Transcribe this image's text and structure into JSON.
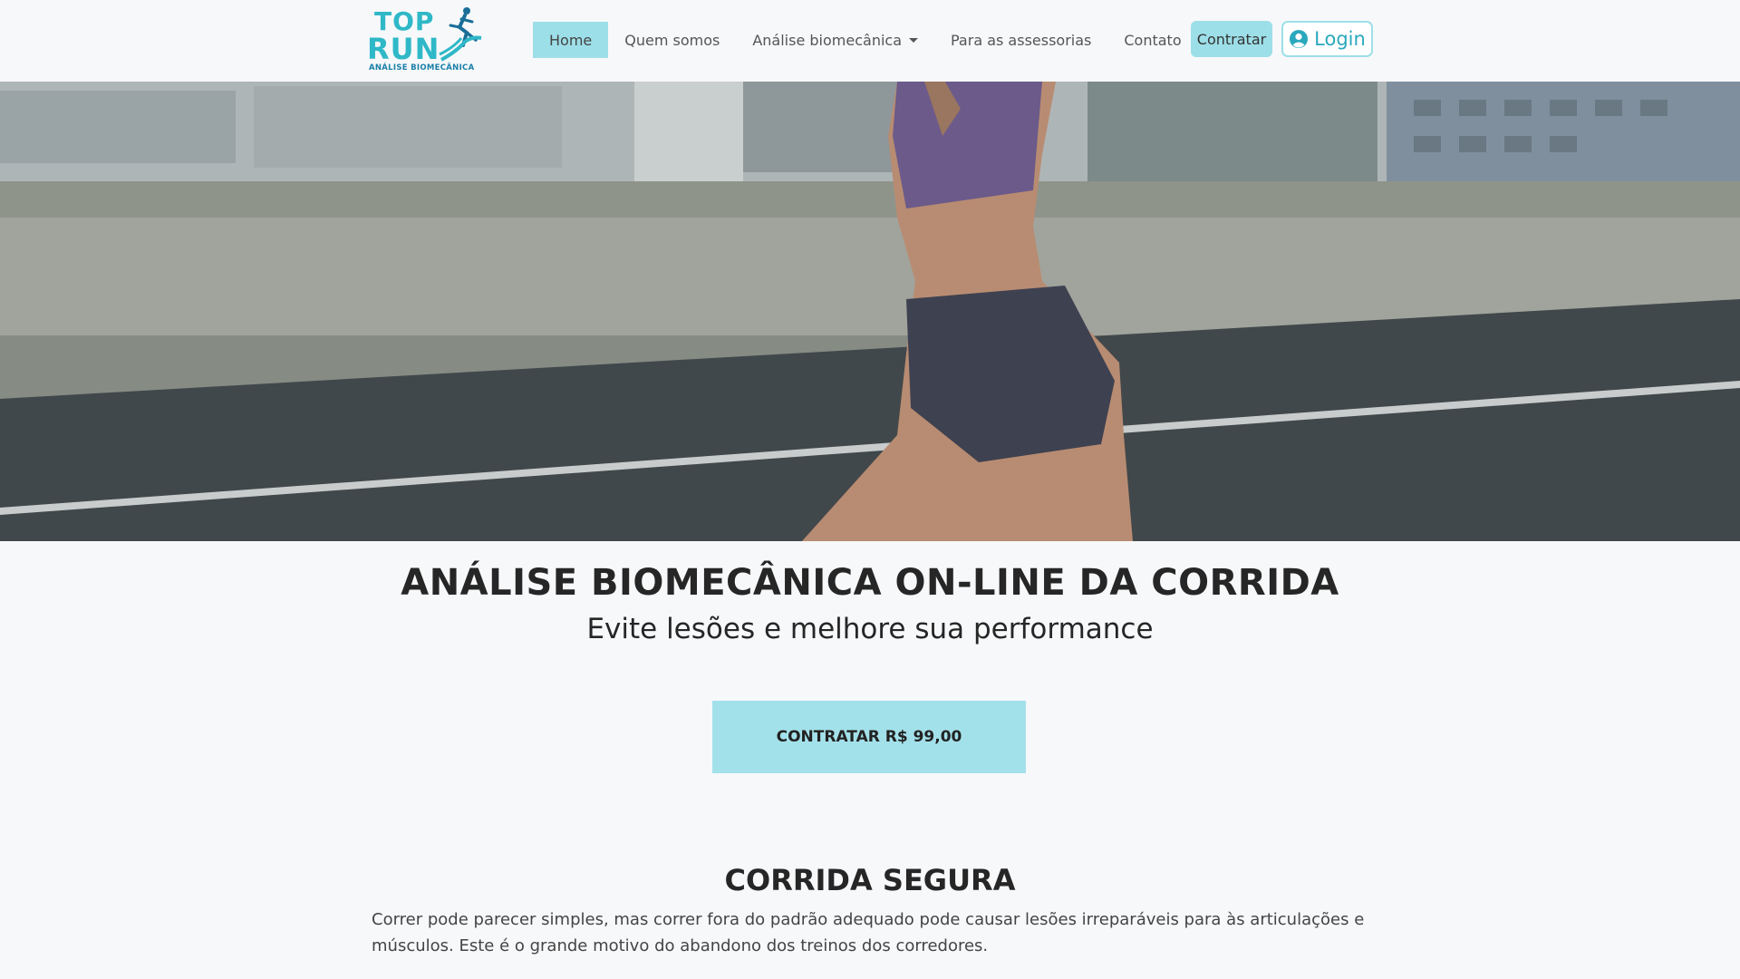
{
  "brand": {
    "logo_line1": "TOP",
    "logo_line2": "RUN",
    "logo_subtitle": "ANÁLISE BIOMECÂNICA",
    "accent_color": "#9ddfe8",
    "logo_color": "#2fb8c7"
  },
  "nav": {
    "items": [
      {
        "label": "Home",
        "active": true
      },
      {
        "label": "Quem somos",
        "active": false
      },
      {
        "label": "Análise biomecânica",
        "active": false,
        "dropdown": true
      },
      {
        "label": "Para as assessorias",
        "active": false
      },
      {
        "label": "Contato",
        "active": false
      }
    ],
    "contratar_label": "Contratar",
    "login_label": "Login",
    "login_icon": "user-circle-icon"
  },
  "hero": {
    "image": "runner-on-bridge-photo"
  },
  "main": {
    "headline": "ANÁLISE BIOMECÂNICA ON-LINE DA CORRIDA",
    "subheadline": "Evite lesões e melhore sua performance",
    "cta_label": "CONTRATAR R$ 99,00",
    "section_title": "CORRIDA SEGURA",
    "section_text": "Correr pode parecer simples, mas correr fora do padrão adequado pode causar lesões irreparáveis para às articulações e músculos. Este é o grande motivo do abandono dos treinos dos corredores."
  }
}
